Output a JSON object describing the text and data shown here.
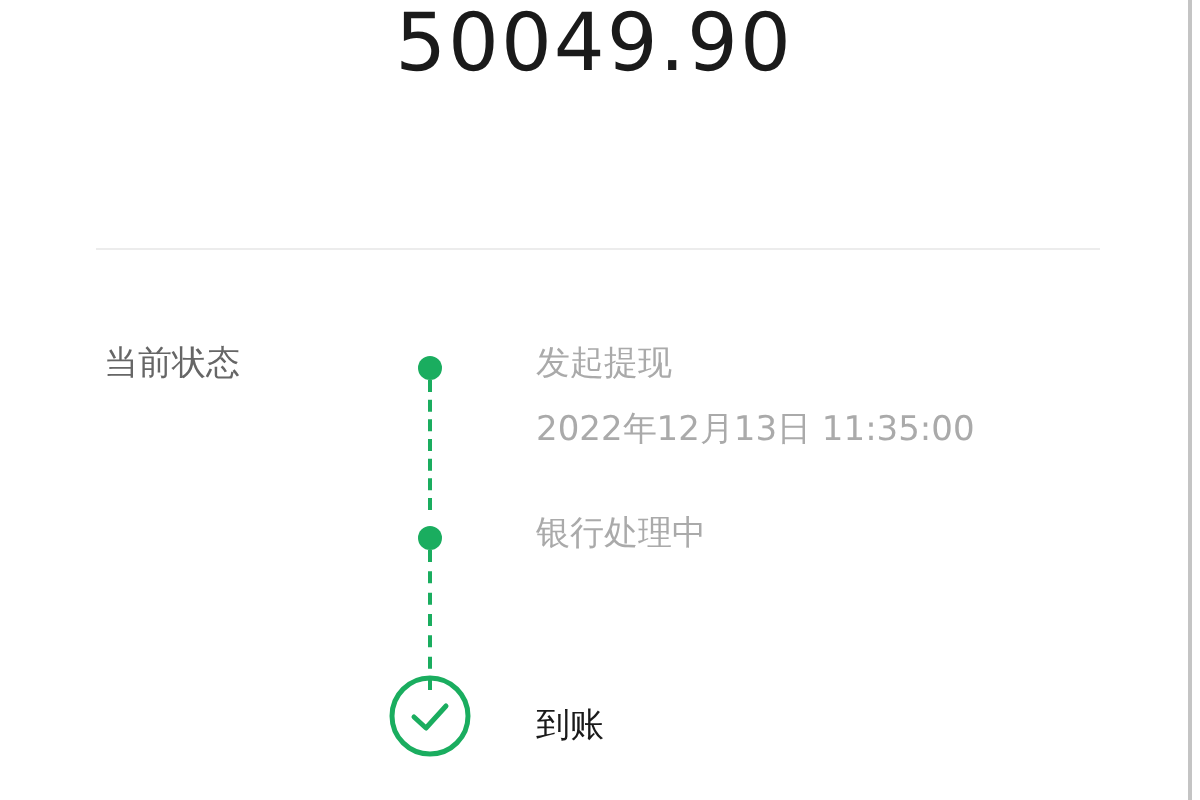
{
  "amount": "50049.90",
  "status_label": "当前状态",
  "steps": [
    {
      "kind": "dot",
      "title": "发起提现",
      "time": "2022年12月13日 11:35:00"
    },
    {
      "kind": "dot",
      "title": "银行处理中"
    },
    {
      "kind": "check",
      "title": "到账"
    }
  ]
}
